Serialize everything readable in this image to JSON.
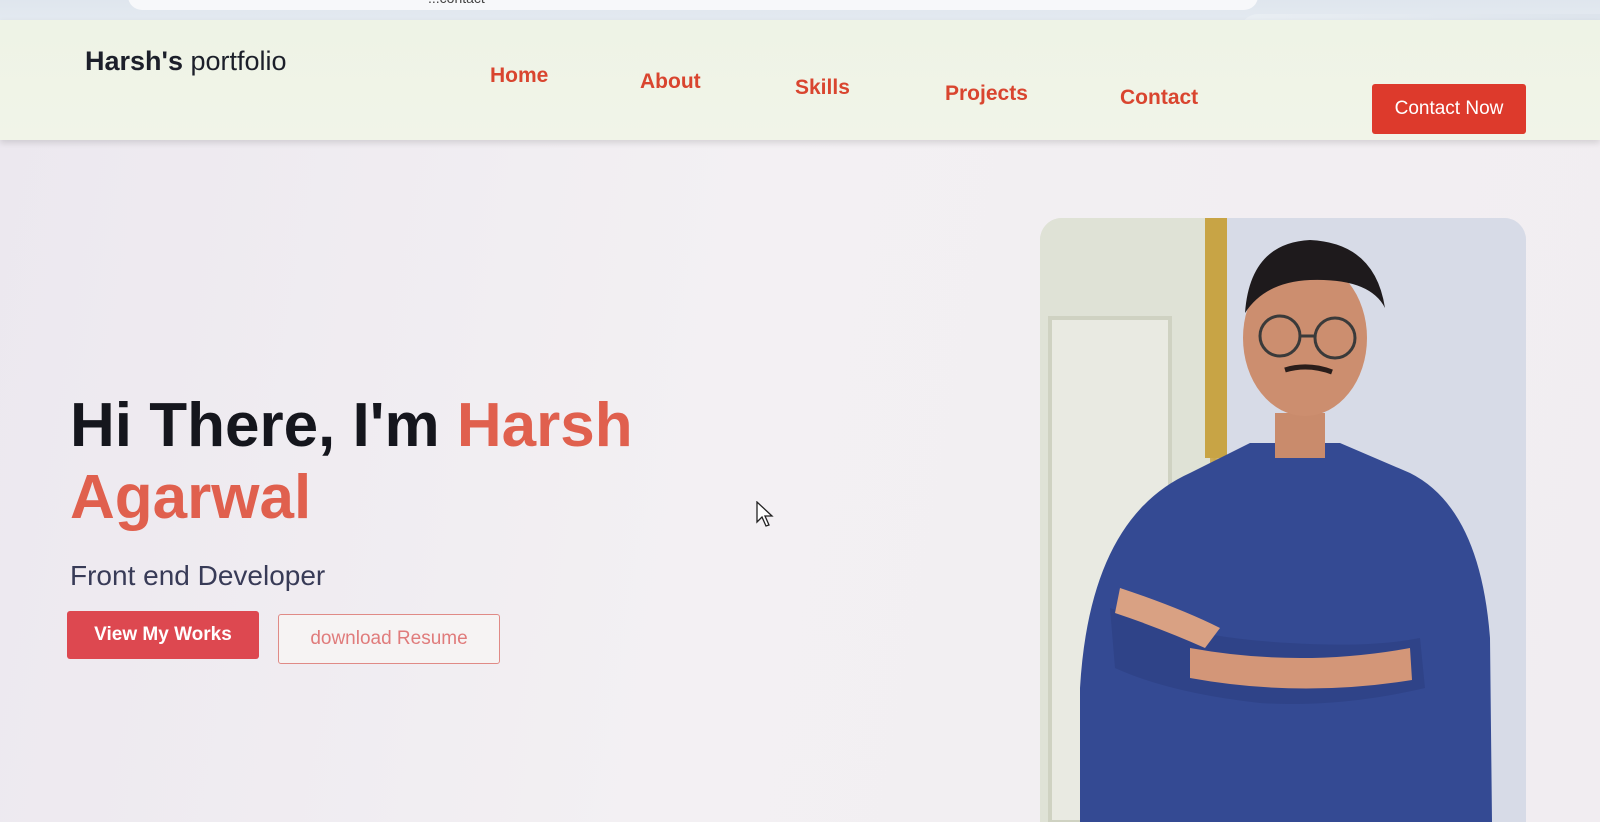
{
  "browser": {
    "url_fragment": "...contact",
    "icons": [
      "read-aloud-icon",
      "favorite-star-icon",
      "split-screen-icon",
      "favorites-list-icon",
      "collections-icon",
      "health-icon"
    ]
  },
  "brand": {
    "bold": "Harsh's",
    "rest": " portfolio"
  },
  "nav": {
    "links": [
      "Home",
      "About",
      "Skills",
      "Projects",
      "Contact"
    ],
    "cta": "Contact Now"
  },
  "hero": {
    "title_plain": "Hi There, I'm ",
    "title_highlight": "Harsh Agarwal",
    "subtitle": "Front end Developer",
    "primary_button": "View My Works",
    "secondary_button": "download Resume"
  },
  "colors": {
    "accent": "#dd3a2c",
    "highlight": "#e0604e",
    "primary_button": "#dd4850",
    "heading": "#15161d"
  },
  "photo": {
    "subject": "portrait of a man with glasses in a blue checked shirt, arms crossed"
  }
}
